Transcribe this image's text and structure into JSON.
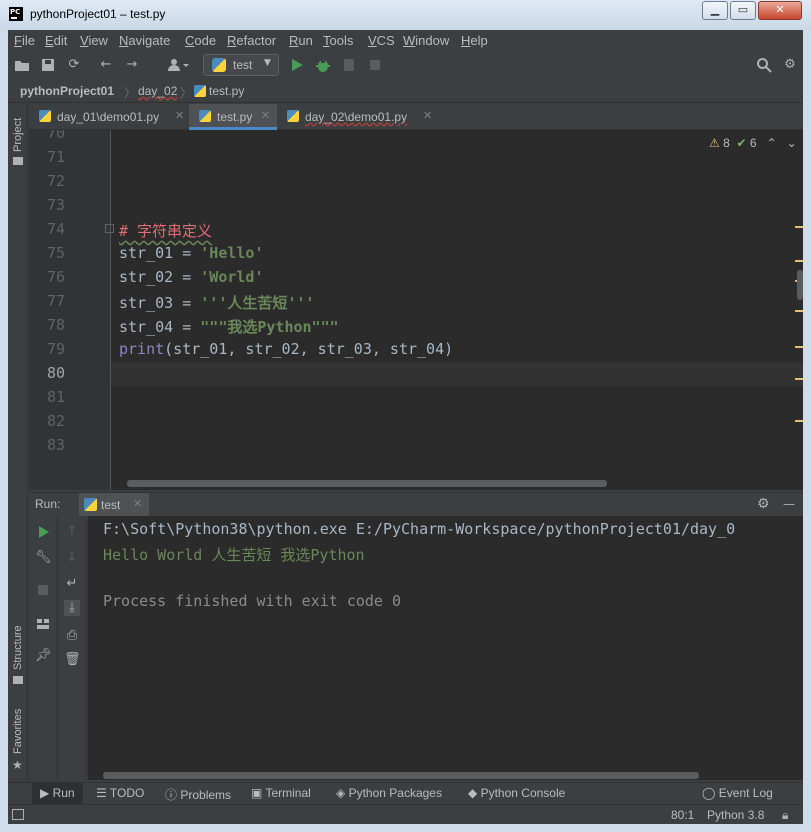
{
  "window": {
    "title": "pythonProject01 – test.py"
  },
  "menu": [
    "File",
    "Edit",
    "View",
    "Navigate",
    "Code",
    "Refactor",
    "Run",
    "Tools",
    "VCS",
    "Window",
    "Help"
  ],
  "toolbar": {
    "run_config": "test"
  },
  "breadcrumb": [
    "pythonProject01",
    "day_02",
    "test.py"
  ],
  "left_strip": {
    "project": "Project",
    "structure": "Structure",
    "favorites": "Favorites"
  },
  "tabs": [
    {
      "label": "day_01\\demo01.py"
    },
    {
      "label": "test.py"
    },
    {
      "label": "day_02\\demo01.py"
    }
  ],
  "editor": {
    "inspections": {
      "warnings": "8",
      "ok": "6"
    },
    "line_numbers": [
      "70",
      "71",
      "72",
      "73",
      "74",
      "75",
      "76",
      "77",
      "78",
      "79",
      "80",
      "81",
      "82",
      "83"
    ],
    "current_line": "80",
    "code": {
      "comment": "# 字符串定义",
      "l75_var": "str_01",
      "l75_eq": " = ",
      "l75_val": "'Hello'",
      "l76_var": "str_02",
      "l76_eq": " = ",
      "l76_val": "'World'",
      "l77_var": "str_03",
      "l77_eq": " = ",
      "l77_val": "'''人生苦短'''",
      "l78_var": "str_04",
      "l78_eq": " = ",
      "l78_val": "\"\"\"我选Python\"\"\"",
      "l79_func": "print",
      "l79_args": "(str_01, str_02, str_03, str_04)"
    }
  },
  "run": {
    "label": "Run:",
    "tab": "test",
    "output": [
      "F:\\Soft\\Python38\\python.exe E:/PyCharm-Workspace/pythonProject01/day_0",
      "Hello World 人生苦短 我选Python",
      "",
      "Process finished with exit code 0"
    ]
  },
  "bottom_tabs": [
    "Run",
    "TODO",
    "Problems",
    "Terminal",
    "Python Packages",
    "Python Console",
    "Event Log"
  ],
  "status": {
    "position": "80:1",
    "interpreter": "Python 3.8"
  },
  "colors": {
    "accent": "#4a88c7",
    "string": "#6a8759",
    "comment": "#e06c75",
    "warning": "#e5c07b",
    "run_green": "#499c54"
  }
}
